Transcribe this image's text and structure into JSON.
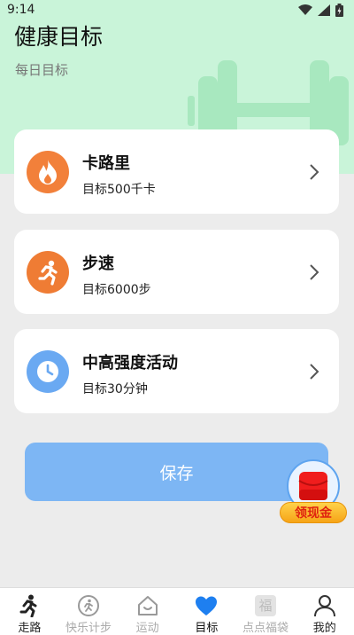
{
  "status_bar": {
    "time": "9:14"
  },
  "header": {
    "title": "健康目标",
    "subtitle": "每日目标"
  },
  "cards": [
    {
      "title": "卡路里",
      "goal": "目标500千卡",
      "icon": "flame-icon",
      "color": "#f2803a"
    },
    {
      "title": "步速",
      "goal": "目标6000步",
      "icon": "running-person-icon",
      "color": "#ef7c34"
    },
    {
      "title": "中高强度活动",
      "goal": "目标30分钟",
      "icon": "clock-icon",
      "color": "#6aa9f2"
    }
  ],
  "save_button": {
    "label": "保存"
  },
  "promo": {
    "label": "领现金"
  },
  "tabbar": {
    "items": [
      {
        "label": "走路",
        "icon": "walking-person-icon"
      },
      {
        "label": "快乐计步",
        "icon": "pedometer-icon"
      },
      {
        "label": "运动",
        "icon": "house-smile-icon"
      },
      {
        "label": "目标",
        "icon": "heart-icon"
      },
      {
        "label": "点点福袋",
        "icon": "fortune-bag-icon",
        "icon_text": "福"
      },
      {
        "label": "我的",
        "icon": "person-icon"
      }
    ]
  },
  "colors": {
    "accent_blue": "#1e7ff0",
    "header_green": "#c9f4d9",
    "save_button": "#7db6f4"
  }
}
